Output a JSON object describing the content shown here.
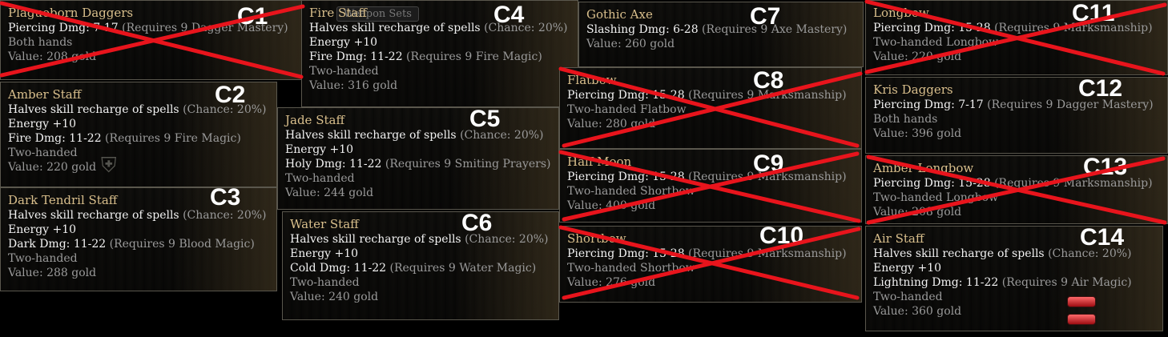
{
  "tab_fragment": "Weapon Sets",
  "cards": [
    {
      "id": "C1",
      "name": "Plagueborn Daggers",
      "lines": [
        {
          "t": "Piercing Dmg: 7-17",
          "r": " (Requires 9 Dagger Mastery)"
        }
      ],
      "gray": [
        "Both hands",
        "Value: 208 gold"
      ],
      "crossed": true
    },
    {
      "id": "C2",
      "name": "Amber Staff",
      "lines": [
        {
          "t": "Halves skill recharge of spells",
          "r": " (Chance: 20%)"
        },
        {
          "t": "Energy +10",
          "r": ""
        },
        {
          "t": "Fire Dmg: 11-22",
          "r": " (Requires 9 Fire Magic)"
        }
      ],
      "gray": [
        "Two-handed",
        "Value: 220 gold"
      ],
      "crossed": false
    },
    {
      "id": "C3",
      "name": "Dark Tendril Staff",
      "lines": [
        {
          "t": "Halves skill recharge of spells",
          "r": " (Chance: 20%)"
        },
        {
          "t": "Energy +10",
          "r": ""
        },
        {
          "t": "Dark Dmg: 11-22",
          "r": " (Requires 9 Blood Magic)"
        }
      ],
      "gray": [
        "Two-handed",
        "Value: 288 gold"
      ],
      "crossed": false
    },
    {
      "id": "C4",
      "name": "Fire Staff",
      "lines": [
        {
          "t": "Halves skill recharge of spells",
          "r": " (Chance: 20%)"
        },
        {
          "t": "Energy +10",
          "r": ""
        },
        {
          "t": "Fire Dmg: 11-22",
          "r": " (Requires 9 Fire Magic)"
        }
      ],
      "gray": [
        "Two-handed",
        "Value: 316 gold"
      ],
      "crossed": false
    },
    {
      "id": "C5",
      "name": "Jade Staff",
      "lines": [
        {
          "t": "Halves skill recharge of spells",
          "r": " (Chance: 20%)"
        },
        {
          "t": "Energy +10",
          "r": ""
        },
        {
          "t": "Holy Dmg: 11-22",
          "r": " (Requires 9 Smiting Prayers)"
        }
      ],
      "gray": [
        "Two-handed",
        "Value: 244 gold"
      ],
      "crossed": false
    },
    {
      "id": "C6",
      "name": "Water Staff",
      "lines": [
        {
          "t": "Halves skill recharge of spells",
          "r": " (Chance: 20%)"
        },
        {
          "t": "Energy +10",
          "r": ""
        },
        {
          "t": "Cold Dmg: 11-22",
          "r": " (Requires 9 Water Magic)"
        }
      ],
      "gray": [
        "Two-handed",
        "Value: 240 gold"
      ],
      "crossed": false
    },
    {
      "id": "C7",
      "name": "Gothic Axe",
      "lines": [
        {
          "t": "Slashing Dmg: 6-28",
          "r": " (Requires 9 Axe Mastery)"
        }
      ],
      "gray": [
        "Value: 260 gold"
      ],
      "crossed": false
    },
    {
      "id": "C8",
      "name": "Flatbow",
      "lines": [
        {
          "t": "Piercing Dmg: 15-28",
          "r": " (Requires 9 Marksmanship)"
        }
      ],
      "gray": [
        "Two-handed Flatbow",
        "Value: 280 gold"
      ],
      "crossed": true
    },
    {
      "id": "C9",
      "name": "Half Moon",
      "lines": [
        {
          "t": "Piercing Dmg: 15-28",
          "r": " (Requires 9 Marksmanship)"
        }
      ],
      "gray": [
        "Two-handed Shortbow",
        "Value: 400 gold"
      ],
      "crossed": true
    },
    {
      "id": "C10",
      "name": "Shortbow",
      "lines": [
        {
          "t": "Piercing Dmg: 15-28",
          "r": " (Requires 9 Marksmanship)"
        }
      ],
      "gray": [
        "Two-handed Shortbow",
        "Value: 276 gold"
      ],
      "crossed": true
    },
    {
      "id": "C11",
      "name": "Longbow",
      "lines": [
        {
          "t": "Piercing Dmg: 15-28",
          "r": " (Requires 9 Marksmanship)"
        }
      ],
      "gray": [
        "Two-handed Longbow",
        "Value: 220 gold"
      ],
      "crossed": true
    },
    {
      "id": "C12",
      "name": "Kris Daggers",
      "lines": [
        {
          "t": "Piercing Dmg: 7-17",
          "r": " (Requires 9 Dagger Mastery)"
        }
      ],
      "gray": [
        "Both hands",
        "Value: 396 gold"
      ],
      "crossed": false
    },
    {
      "id": "C13",
      "name": "Amber Longbow",
      "lines": [
        {
          "t": "Piercing Dmg: 15-28",
          "r": " (Requires 9 Marksmanship)"
        }
      ],
      "gray": [
        "Two-handed Longbow",
        "Value: 208 gold"
      ],
      "crossed": true
    },
    {
      "id": "C14",
      "name": "Air Staff",
      "lines": [
        {
          "t": "Halves skill recharge of spells",
          "r": " (Chance: 20%)"
        },
        {
          "t": "Energy +10",
          "r": ""
        },
        {
          "t": "Lightning Dmg: 11-22",
          "r": " (Requires 9 Air Magic)"
        }
      ],
      "gray": [
        "Two-handed",
        "Value: 360 gold"
      ],
      "crossed": false
    }
  ],
  "colors": {
    "name": "#d9bf8c",
    "stat": "#f2f2f2",
    "requirement": "#9a9a9a",
    "label": "#ffffff",
    "cross": "#e8141c",
    "background": "#000000"
  }
}
